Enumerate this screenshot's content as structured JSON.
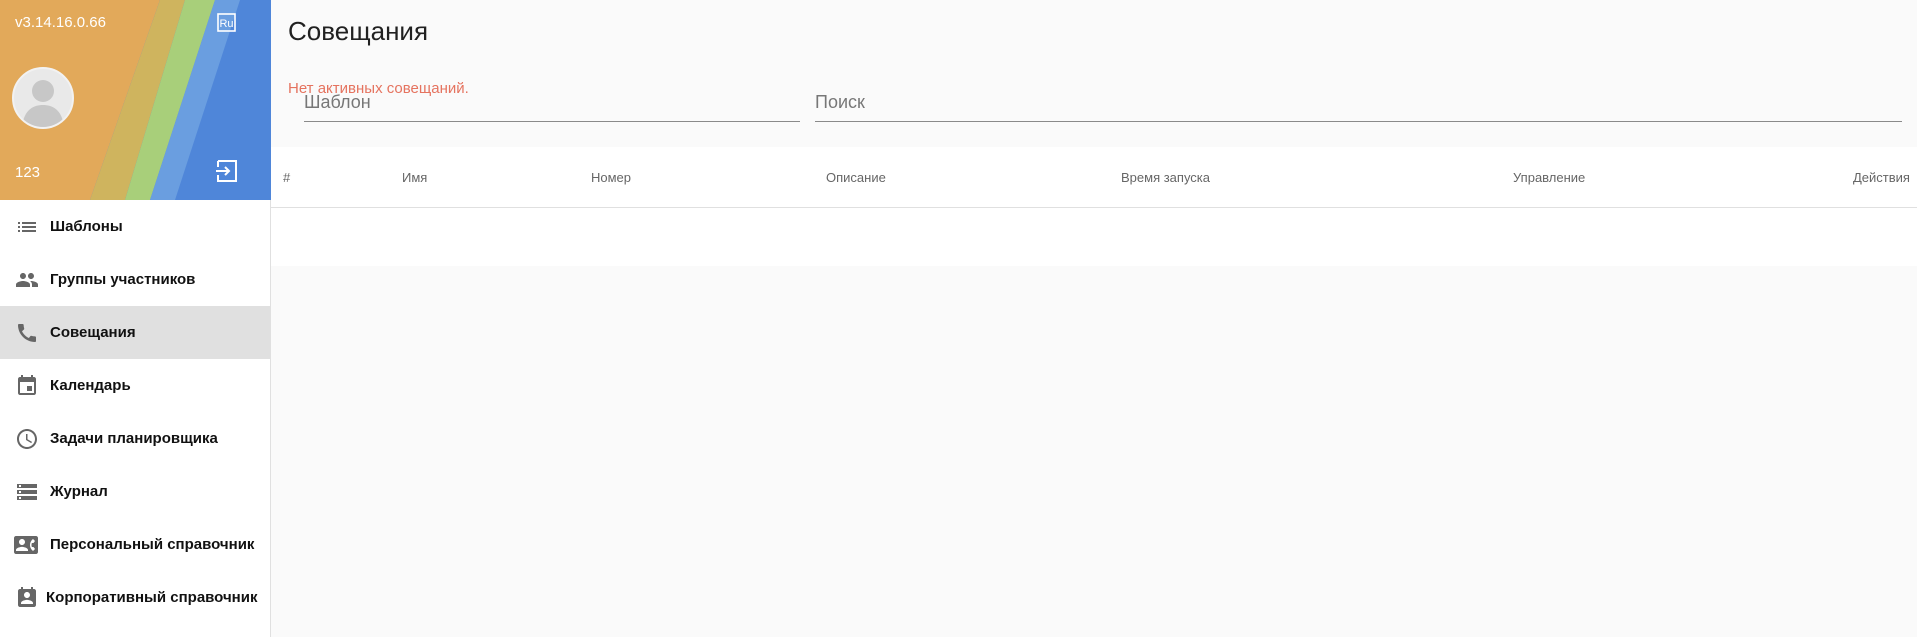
{
  "app": {
    "version": "v3.14.16.0.66",
    "language_badge": "Ru",
    "user_name": "123"
  },
  "sidebar": {
    "items": [
      {
        "label": "Шаблоны",
        "icon": "list-icon"
      },
      {
        "label": "Группы участников",
        "icon": "people-icon"
      },
      {
        "label": "Совещания",
        "icon": "phone-icon",
        "active": true
      },
      {
        "label": "Календарь",
        "icon": "calendar-icon"
      },
      {
        "label": "Задачи планировщика",
        "icon": "clock-icon"
      },
      {
        "label": "Журнал",
        "icon": "storage-icon"
      },
      {
        "label": "Персональный справочник",
        "icon": "contact-card-icon"
      },
      {
        "label": "Корпоративный справочник",
        "icon": "contact-badge-icon"
      }
    ]
  },
  "main": {
    "title": "Совещания",
    "template_placeholder": "Шаблон",
    "search_placeholder": "Поиск",
    "table": {
      "columns": [
        "#",
        "Имя",
        "Номер",
        "Описание",
        "Время запуска",
        "Управление",
        "Действия"
      ],
      "empty_message": "Нет активных совещаний."
    }
  },
  "colors": {
    "accent_blue": "#4f86d9",
    "empty_message": "#e5735f",
    "active_nav_bg": "#e0e0e0"
  }
}
